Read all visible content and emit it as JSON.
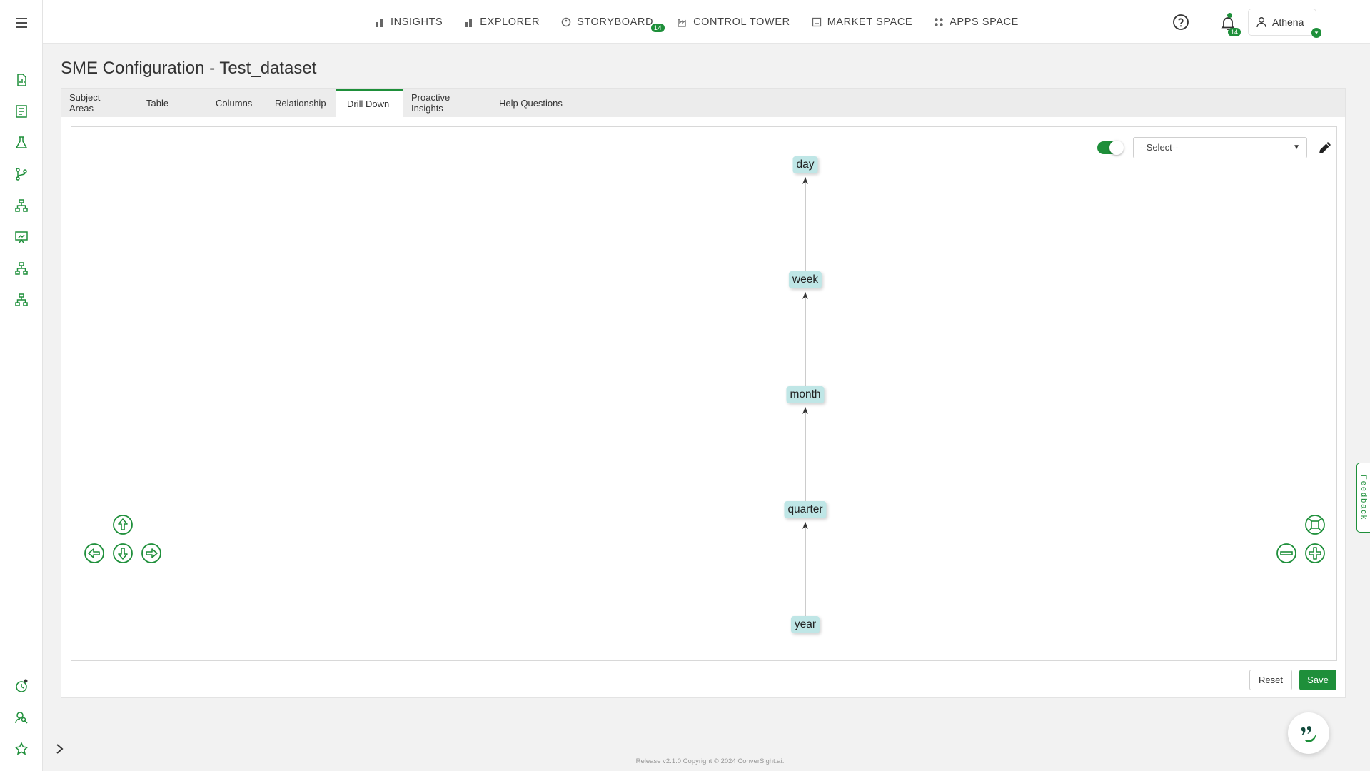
{
  "topnav": {
    "items": [
      {
        "label": "INSIGHTS",
        "icon": "bar-chart-icon"
      },
      {
        "label": "EXPLORER",
        "icon": "bar-chart-icon"
      },
      {
        "label": "STORYBOARD",
        "icon": "palette-icon",
        "badge": "14"
      },
      {
        "label": "CONTROL TOWER",
        "icon": "factory-icon"
      },
      {
        "label": "MARKET SPACE",
        "icon": "store-icon"
      },
      {
        "label": "APPS SPACE",
        "icon": "grid-icon"
      }
    ],
    "notification_count": "14",
    "user_name": "Athena"
  },
  "sidebar": {
    "icons": [
      "menu-icon",
      "file-chart-icon",
      "report-icon",
      "flask-icon",
      "git-branch-icon",
      "hierarchy-icon",
      "presentation-icon",
      "hierarchy-icon",
      "hierarchy-icon",
      "clock-refresh-icon",
      "user-search-icon",
      "star-icon"
    ]
  },
  "page": {
    "title": "SME Configuration - Test_dataset"
  },
  "tabs": [
    {
      "label": "Subject Areas",
      "active": false
    },
    {
      "label": "Table",
      "active": false
    },
    {
      "label": "Columns",
      "active": false
    },
    {
      "label": "Relationship",
      "active": false
    },
    {
      "label": "Drill Down",
      "active": true
    },
    {
      "label": "Proactive Insights",
      "active": false
    },
    {
      "label": "Help Questions",
      "active": false
    }
  ],
  "drilldown": {
    "toggle_on": true,
    "select_placeholder": "--Select--",
    "nodes": [
      "day",
      "week",
      "month",
      "quarter",
      "year"
    ],
    "edges": [
      {
        "from": "week",
        "to": "day"
      },
      {
        "from": "month",
        "to": "week"
      },
      {
        "from": "quarter",
        "to": "month"
      },
      {
        "from": "year",
        "to": "quarter"
      }
    ]
  },
  "actions": {
    "reset_label": "Reset",
    "save_label": "Save"
  },
  "feedback_label": "Feedback",
  "footer": "Release v2.1.0 Copyright © 2024 ConverSight.ai.",
  "colors": {
    "accent": "#1e8f3a",
    "node_bg": "#bfe6e6"
  }
}
